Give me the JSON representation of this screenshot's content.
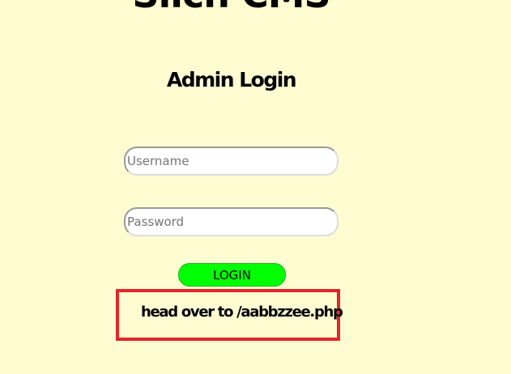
{
  "site": {
    "title": "Silch CMS"
  },
  "login_form": {
    "heading": "Admin Login",
    "username": {
      "value": "",
      "placeholder": "Username"
    },
    "password": {
      "value": "",
      "placeholder": "Password"
    },
    "submit_label": "LOGIN"
  },
  "annotation": {
    "text": "head over to /aabbzzee.php",
    "border_color": "#e3262a"
  },
  "colors": {
    "background": "#fffcd1",
    "button": "#00ff00"
  }
}
